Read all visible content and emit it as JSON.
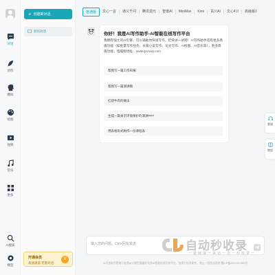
{
  "rail": {
    "items": [
      {
        "label": "对话",
        "icon": "chat-bubble-icon",
        "active": true
      },
      {
        "label": "创作",
        "icon": "feather-icon"
      },
      {
        "label": "模拟",
        "icon": "head-profile-icon"
      },
      {
        "label": "绘图",
        "icon": "palette-icon"
      },
      {
        "label": "视频",
        "icon": "video-icon"
      },
      {
        "label": "音乐",
        "icon": "music-note-icon"
      },
      {
        "label": "更多",
        "icon": "grid-icon"
      },
      {
        "label": "AI搜索",
        "icon": "search-icon"
      },
      {
        "label": "模型",
        "icon": "settings-icon"
      }
    ]
  },
  "sidebar": {
    "new_chat_label": "创建新对话",
    "conversation_label": "新的对话",
    "member": {
      "title": "开通会员",
      "subtitle": "高速通道 无限对话",
      "badge": "V"
    }
  },
  "tabs": [
    "普通版",
    "文心一言",
    "通义千问",
    "腾讯混元",
    "智谱AI",
    "MiniMax",
    "Kimi",
    "百川AI",
    "文心4.0",
    "高级版1"
  ],
  "message": {
    "title": "你好！我是AI写作助手-AI智能在线写作平台",
    "description": "我拥有强大的AI引擎，可以辅助你快速写作，赶快试一试吧！AI写作助手还有更多高级功能（如批量写作任务、长篇小说写作、论文写作、AI绘图、AI音乐等），更多高级功能，电脑版地址：www.tjszxwy.com",
    "suggestions": [
      "帮我写一篇工作日报",
      "帮我写一篇演讲稿",
      "红烧牛肉的做法",
      "生成一篇关于环境保护的演讲PPT",
      "用表格形式制作一份课程表"
    ]
  },
  "floating": [
    {
      "label": "客服",
      "icon": "headset-icon"
    },
    {
      "label": "教程",
      "icon": "book-icon"
    }
  ],
  "input": {
    "placeholder": "输入您的问题，Ctrl+回车发送"
  },
  "watermark": {
    "text": "自动秒收录",
    "subtext": "一键链接一来访一次一秒收录一"
  },
  "footer": "AI写作助手是基于各类AI大模型搭建的写作AI智能在线写作平台，仅用于技术研究、禁止一切违法用途   蜀ICP备2021021969号",
  "colors": {
    "accent": "#1aa6b7",
    "member_bg": "#fff2cf",
    "member_badge": "#f5a623"
  }
}
